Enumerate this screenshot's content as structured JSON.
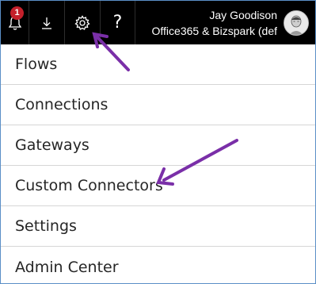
{
  "topbar": {
    "notifications": {
      "icon": "bell-icon",
      "badge_count": "1"
    },
    "download": {
      "icon": "download-icon"
    },
    "settings": {
      "icon": "gear-icon"
    },
    "help": {
      "icon": "help-icon",
      "glyph": "?"
    },
    "account": {
      "name": "Jay Goodison",
      "org": "Office365 & Bizspark (def",
      "avatar_icon": "avatar-icon"
    }
  },
  "menu": {
    "items": [
      {
        "label": "Flows"
      },
      {
        "label": "Connections"
      },
      {
        "label": "Gateways"
      },
      {
        "label": "Custom Connectors"
      },
      {
        "label": "Settings"
      },
      {
        "label": "Admin Center"
      }
    ]
  },
  "colors": {
    "topbar_bg": "#000000",
    "badge_bg": "#c4202b",
    "annotation_arrow": "#7a2fa8",
    "frame_border": "#5b8fc7"
  }
}
